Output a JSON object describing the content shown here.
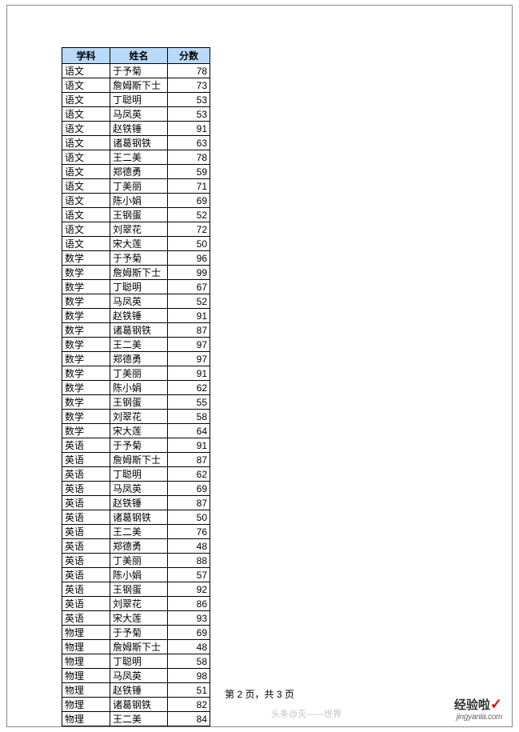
{
  "headers": {
    "subject": "学科",
    "name": "姓名",
    "score": "分数"
  },
  "footer": "第 2 页，共 3 页",
  "watermark_left": "头条@灭——世界",
  "watermark_brand": "经验啦",
  "watermark_check": "✓",
  "watermark_url": "jingyanla.com",
  "rows": [
    {
      "subject": "语文",
      "name": "于予菊",
      "score": 78
    },
    {
      "subject": "语文",
      "name": "詹姆斯下士",
      "score": 73
    },
    {
      "subject": "语文",
      "name": "丁聪明",
      "score": 53
    },
    {
      "subject": "语文",
      "name": "马凤英",
      "score": 53
    },
    {
      "subject": "语文",
      "name": "赵铁锤",
      "score": 91
    },
    {
      "subject": "语文",
      "name": "诸葛钢铁",
      "score": 63
    },
    {
      "subject": "语文",
      "name": "王二美",
      "score": 78
    },
    {
      "subject": "语文",
      "name": "郑德勇",
      "score": 59
    },
    {
      "subject": "语文",
      "name": "丁美丽",
      "score": 71
    },
    {
      "subject": "语文",
      "name": "陈小娟",
      "score": 69
    },
    {
      "subject": "语文",
      "name": "王钢蛋",
      "score": 52
    },
    {
      "subject": "语文",
      "name": "刘翠花",
      "score": 72
    },
    {
      "subject": "语文",
      "name": "宋大莲",
      "score": 50
    },
    {
      "subject": "数学",
      "name": "于予菊",
      "score": 96
    },
    {
      "subject": "数学",
      "name": "詹姆斯下士",
      "score": 99
    },
    {
      "subject": "数学",
      "name": "丁聪明",
      "score": 67
    },
    {
      "subject": "数学",
      "name": "马凤英",
      "score": 52
    },
    {
      "subject": "数学",
      "name": "赵铁锤",
      "score": 91
    },
    {
      "subject": "数学",
      "name": "诸葛钢铁",
      "score": 87
    },
    {
      "subject": "数学",
      "name": "王二美",
      "score": 97
    },
    {
      "subject": "数学",
      "name": "郑德勇",
      "score": 97
    },
    {
      "subject": "数学",
      "name": "丁美丽",
      "score": 91
    },
    {
      "subject": "数学",
      "name": "陈小娟",
      "score": 62
    },
    {
      "subject": "数学",
      "name": "王钢蛋",
      "score": 55
    },
    {
      "subject": "数学",
      "name": "刘翠花",
      "score": 58
    },
    {
      "subject": "数学",
      "name": "宋大莲",
      "score": 64
    },
    {
      "subject": "英语",
      "name": "于予菊",
      "score": 91
    },
    {
      "subject": "英语",
      "name": "詹姆斯下士",
      "score": 87
    },
    {
      "subject": "英语",
      "name": "丁聪明",
      "score": 62
    },
    {
      "subject": "英语",
      "name": "马凤英",
      "score": 69
    },
    {
      "subject": "英语",
      "name": "赵铁锤",
      "score": 87
    },
    {
      "subject": "英语",
      "name": "诸葛钢铁",
      "score": 50
    },
    {
      "subject": "英语",
      "name": "王二美",
      "score": 76
    },
    {
      "subject": "英语",
      "name": "郑德勇",
      "score": 48
    },
    {
      "subject": "英语",
      "name": "丁美丽",
      "score": 88
    },
    {
      "subject": "英语",
      "name": "陈小娟",
      "score": 57
    },
    {
      "subject": "英语",
      "name": "王钢蛋",
      "score": 92
    },
    {
      "subject": "英语",
      "name": "刘翠花",
      "score": 86
    },
    {
      "subject": "英语",
      "name": "宋大莲",
      "score": 93
    },
    {
      "subject": "物理",
      "name": "于予菊",
      "score": 69
    },
    {
      "subject": "物理",
      "name": "詹姆斯下士",
      "score": 48
    },
    {
      "subject": "物理",
      "name": "丁聪明",
      "score": 58
    },
    {
      "subject": "物理",
      "name": "马凤英",
      "score": 98
    },
    {
      "subject": "物理",
      "name": "赵铁锤",
      "score": 51
    },
    {
      "subject": "物理",
      "name": "诸葛钢铁",
      "score": 82
    },
    {
      "subject": "物理",
      "name": "王二美",
      "score": 84
    }
  ]
}
